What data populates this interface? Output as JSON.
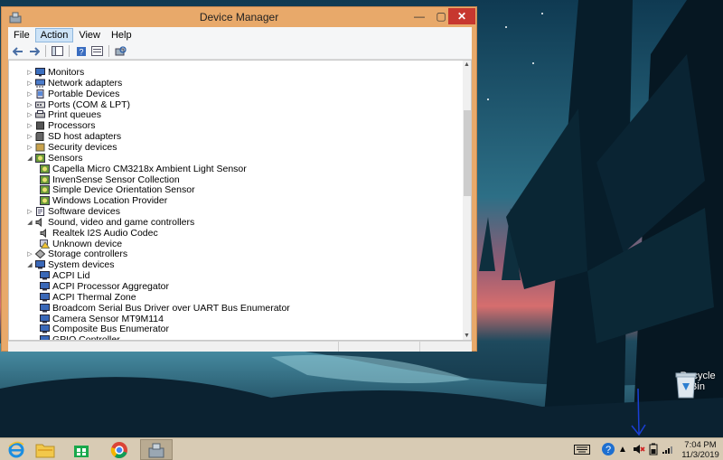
{
  "window": {
    "title": "Device Manager",
    "menu": [
      "File",
      "Action",
      "View",
      "Help"
    ],
    "active_menu": "Action",
    "controls": {
      "minimize": "—",
      "maximize": "▢",
      "close": "✕"
    }
  },
  "tree": [
    {
      "label": "Monitors",
      "level": 1,
      "state": "collapsed",
      "icon": "monitor-icon"
    },
    {
      "label": "Network adapters",
      "level": 1,
      "state": "collapsed",
      "icon": "network-adapter-icon"
    },
    {
      "label": "Portable Devices",
      "level": 1,
      "state": "collapsed",
      "icon": "portable-device-icon"
    },
    {
      "label": "Ports (COM & LPT)",
      "level": 1,
      "state": "collapsed",
      "icon": "port-icon"
    },
    {
      "label": "Print queues",
      "level": 1,
      "state": "collapsed",
      "icon": "printer-icon"
    },
    {
      "label": "Processors",
      "level": 1,
      "state": "collapsed",
      "icon": "processor-icon"
    },
    {
      "label": "SD host adapters",
      "level": 1,
      "state": "collapsed",
      "icon": "sd-card-icon"
    },
    {
      "label": "Security devices",
      "level": 1,
      "state": "collapsed",
      "icon": "security-device-icon"
    },
    {
      "label": "Sensors",
      "level": 1,
      "state": "expanded",
      "icon": "sensor-icon"
    },
    {
      "label": "Capella Micro CM3218x Ambient Light Sensor",
      "level": 2,
      "state": "leaf",
      "icon": "sensor-icon"
    },
    {
      "label": "InvenSense Sensor Collection",
      "level": 2,
      "state": "leaf",
      "icon": "sensor-icon"
    },
    {
      "label": "Simple Device Orientation Sensor",
      "level": 2,
      "state": "leaf",
      "icon": "sensor-icon"
    },
    {
      "label": "Windows Location Provider",
      "level": 2,
      "state": "leaf",
      "icon": "sensor-icon"
    },
    {
      "label": "Software devices",
      "level": 1,
      "state": "collapsed",
      "icon": "software-device-icon"
    },
    {
      "label": "Sound, video and game controllers",
      "level": 1,
      "state": "expanded",
      "icon": "speaker-icon"
    },
    {
      "label": "Realtek I2S Audio Codec",
      "level": 2,
      "state": "leaf",
      "icon": "speaker-icon"
    },
    {
      "label": "Unknown device",
      "level": 2,
      "state": "leaf",
      "icon": "warning-icon"
    },
    {
      "label": "Storage controllers",
      "level": 1,
      "state": "collapsed",
      "icon": "storage-controller-icon"
    },
    {
      "label": "System devices",
      "level": 1,
      "state": "expanded",
      "icon": "system-device-icon"
    },
    {
      "label": "ACPI Lid",
      "level": 2,
      "state": "leaf",
      "icon": "system-device-icon"
    },
    {
      "label": "ACPI Processor Aggregator",
      "level": 2,
      "state": "leaf",
      "icon": "system-device-icon"
    },
    {
      "label": "ACPI Thermal Zone",
      "level": 2,
      "state": "leaf",
      "icon": "system-device-icon"
    },
    {
      "label": "Broadcom Serial Bus Driver over UART Bus Enumerator",
      "level": 2,
      "state": "leaf",
      "icon": "system-device-icon"
    },
    {
      "label": "Camera Sensor MT9M114",
      "level": 2,
      "state": "leaf",
      "icon": "system-device-icon"
    },
    {
      "label": "Composite Bus Enumerator",
      "level": 2,
      "state": "leaf",
      "icon": "system-device-icon"
    },
    {
      "label": "GPIO Controller",
      "level": 2,
      "state": "leaf",
      "icon": "system-device-icon"
    }
  ],
  "desktop": {
    "recycle_bin_label": "Recycle Bin"
  },
  "taskbar": {
    "apps": [
      {
        "name": "internet-explorer-icon",
        "active": false
      },
      {
        "name": "file-explorer-icon",
        "active": false
      },
      {
        "name": "store-icon",
        "active": false
      },
      {
        "name": "chrome-icon",
        "active": false
      },
      {
        "name": "device-manager-icon",
        "active": true
      }
    ],
    "time": "7:04 PM",
    "date": "11/3/2019"
  },
  "colors": {
    "window_frame": "#e8a96a",
    "close_button": "#c7372f",
    "taskbar": "#d8cbb4",
    "annotation_pen": "#1a3fd6"
  }
}
